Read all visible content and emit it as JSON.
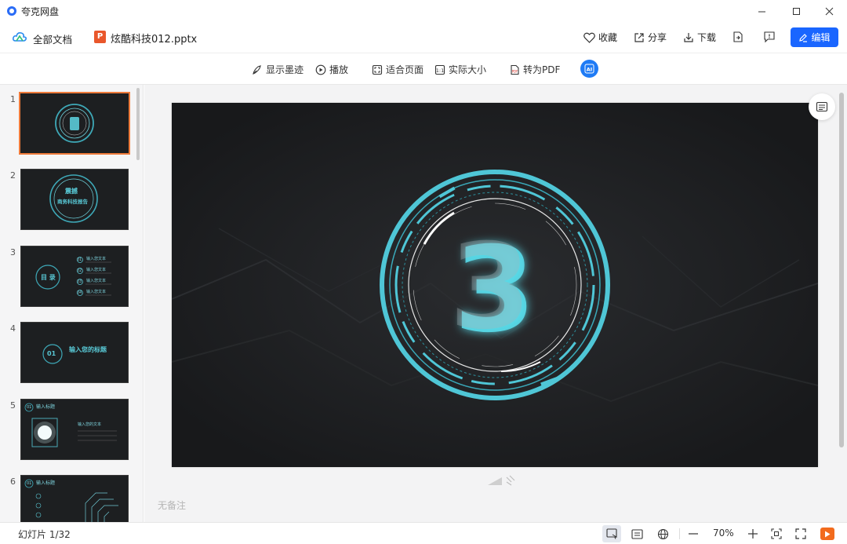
{
  "app": {
    "name": "夸克网盘"
  },
  "header": {
    "all_docs": "全部文档",
    "file_name": "炫酷科技012.pptx",
    "favorite": "收藏",
    "share": "分享",
    "download": "下载",
    "edit": "编辑"
  },
  "toolbar": {
    "show_ink": "显示墨迹",
    "play": "播放",
    "fit_page": "适合页面",
    "actual_size": "实际大小",
    "to_pdf": "转为PDF"
  },
  "thumbnails": [
    {
      "num": "1"
    },
    {
      "num": "2",
      "title": "震撼",
      "subtitle": "商务科技报告"
    },
    {
      "num": "3",
      "title": "目 录",
      "items": [
        "01",
        "02",
        "03",
        "04"
      ],
      "item_text": "输入您文本"
    },
    {
      "num": "4",
      "badge": "01",
      "title": "输入您的标题"
    },
    {
      "num": "5",
      "badge": "01",
      "title": "输入标题",
      "text": "输入您的文本"
    },
    {
      "num": "6",
      "badge": "01",
      "title": "输入标题"
    }
  ],
  "main": {
    "slide_number_glyph": "3",
    "notes_placeholder": "无备注"
  },
  "status": {
    "slide_count": "幻灯片 1/32",
    "zoom": "70%"
  },
  "colors": {
    "accent": "#1a66ff",
    "selected_border": "#ee7a3a",
    "slide_cyan": "#4fc6d6",
    "play_orange": "#f26b1d"
  }
}
